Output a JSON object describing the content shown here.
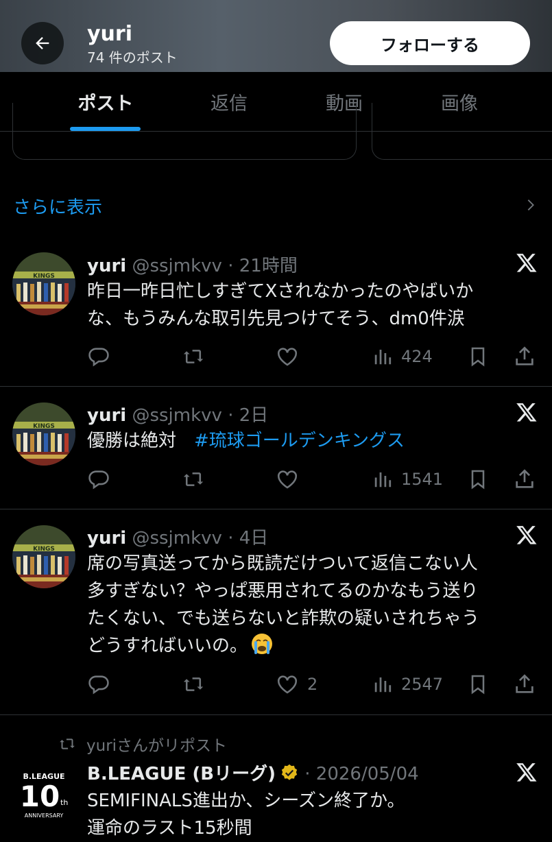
{
  "header": {
    "back_label": "←",
    "name": "yuri",
    "post_count": "74 件のポスト",
    "follow_label": "フォローする"
  },
  "tabs": [
    {
      "label": "ポスト",
      "active": true
    },
    {
      "label": "返信",
      "active": false
    },
    {
      "label": "動画",
      "active": false
    },
    {
      "label": "画像",
      "active": false
    }
  ],
  "show_more": "さらに表示",
  "posts": [
    {
      "name": "yuri",
      "handle": "@ssjmkvv",
      "sep": "·",
      "time": "21時間",
      "text_lines": [
        "昨日一昨日忙しすぎてXされなかったのやばいか",
        "な、もうみんな取引先見つけてそう、dm0件涙"
      ],
      "likes": "",
      "views": "424"
    },
    {
      "name": "yuri",
      "handle": "@ssjmkvv",
      "sep": "·",
      "time": "2日",
      "text": "優勝は絶対　",
      "hashtag": "#琉球ゴールデンキングス",
      "likes": "",
      "views": "1541"
    },
    {
      "name": "yuri",
      "handle": "@ssjmkvv",
      "sep": "·",
      "time": "4日",
      "text_lines": [
        "席の写真送ってから既読だけついて返信こない人",
        "多すぎない？やっぱ悪用されてるのかなもう送り",
        "たくない、でも送らないと詐欺の疑いされちゃう",
        "どうすればいいの。"
      ],
      "likes": "2",
      "views": "2547"
    },
    {
      "repost_label": "yuriさんがリポスト",
      "name": "B.LEAGUE (Bリーグ)",
      "sep": "·",
      "time": "2026/05/04",
      "text_lines": [
        "SEMIFINALS進出か、シーズン終了か。",
        "運命のラスト15秒間"
      ],
      "logo": {
        "brand": "B.LEAGUE",
        "big": "10",
        "sup": "th",
        "sub": "ANNIVERSARY"
      }
    }
  ],
  "colors": {
    "accent": "#1d9bf0",
    "muted": "#71767b",
    "text": "#e7e9ea",
    "bg": "#000000",
    "gold_badge": "#e2b719"
  }
}
